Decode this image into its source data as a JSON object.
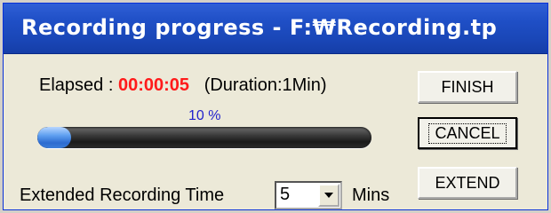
{
  "window": {
    "title": "Recording progress - F:₩Recording.tp"
  },
  "status": {
    "elapsed_label": "Elapsed  :",
    "elapsed_value": "00:00:05",
    "duration_text": "(Duration:1Min)"
  },
  "progress": {
    "percent_text": "10 %",
    "value": 0.1
  },
  "extend": {
    "label": "Extended Recording Time",
    "selected_value": "5",
    "unit": "Mins"
  },
  "buttons": {
    "finish": "FINISH",
    "cancel": "CANCEL",
    "extend": "EXTEND"
  },
  "colors": {
    "elapsed_value": "#ff1a1a",
    "percent_text": "#2222cc",
    "title_bar": "#1f4fc6"
  },
  "icons": {
    "dropdown": "chevron-down-icon"
  }
}
